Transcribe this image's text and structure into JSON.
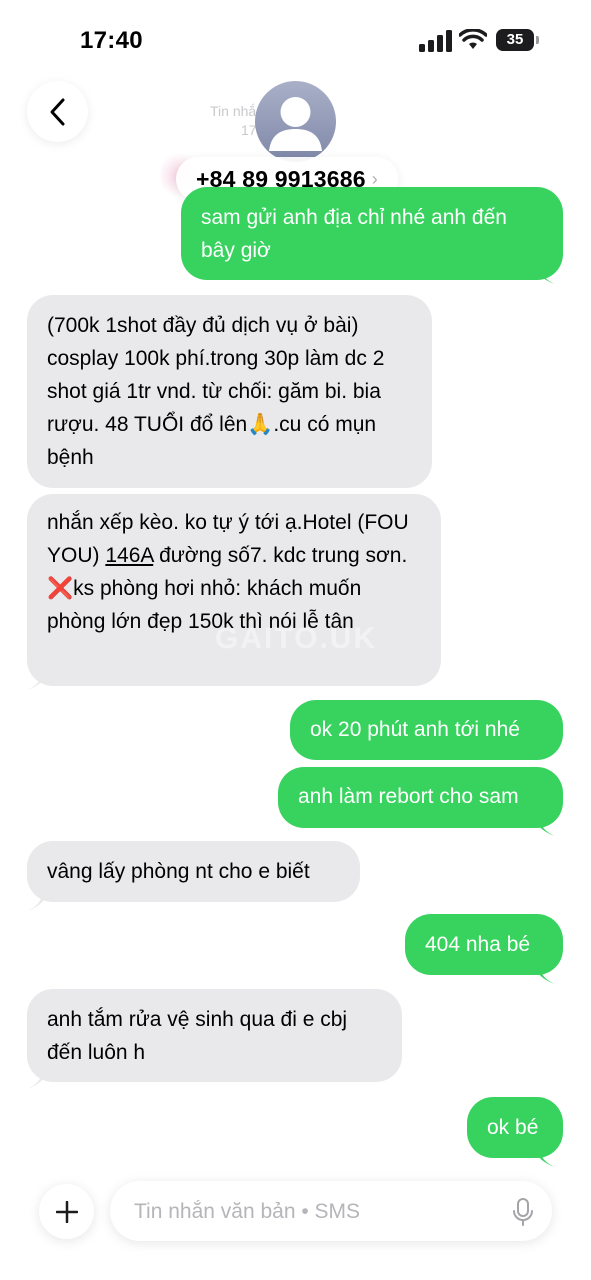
{
  "status_bar": {
    "time": "17:40",
    "battery": "35"
  },
  "header": {
    "faded_line_1": "Tin nhắn • SMS",
    "faded_line_2": "17:... nay",
    "contact": "+84 89 9913686",
    "chevron": "›"
  },
  "watermark": "GAITO.UK",
  "messages": [
    {
      "dir": "out",
      "text": "sam gửi anh địa chỉ nhé anh đến bây giờ"
    },
    {
      "dir": "in",
      "text": "(700k 1shot đầy đủ dịch vụ ở bài) cosplay 100k phí.trong 30p làm dc 2 shot giá 1tr vnd. từ chối: găm bi. bia rượu. 48 TUỔI đổ lên🙏.cu có mụn bệnh"
    },
    {
      "dir": "in",
      "part1": "nhắn xếp kèo. ko tự ý tới ạ.Hotel (FOU YOU) ",
      "link": "146A",
      "part2": " đường số7. kdc trung sơn. ❌ks phòng hơi nhỏ: khách muốn phòng lớn đẹp 150k thì nói lễ tân"
    },
    {
      "dir": "out",
      "text": "ok 20 phút anh tới nhé"
    },
    {
      "dir": "out",
      "text": "anh làm rebort cho sam"
    },
    {
      "dir": "in",
      "text": "vâng lấy phòng nt cho e biết"
    },
    {
      "dir": "out",
      "text": "404 nha bé"
    },
    {
      "dir": "in",
      "text": "anh tắm rửa vệ sinh qua đi e cbj đến luôn h"
    },
    {
      "dir": "out",
      "text": "ok bé"
    }
  ],
  "composer": {
    "placeholder": "Tin nhắn văn bản • SMS"
  },
  "colors": {
    "outgoing": "#38d35f",
    "incoming": "#e9e9eb"
  },
  "icons": [
    "back-chevron-icon",
    "avatar-icon",
    "plus-icon",
    "mic-icon",
    "signal-icon",
    "wifi-icon",
    "battery-icon"
  ]
}
